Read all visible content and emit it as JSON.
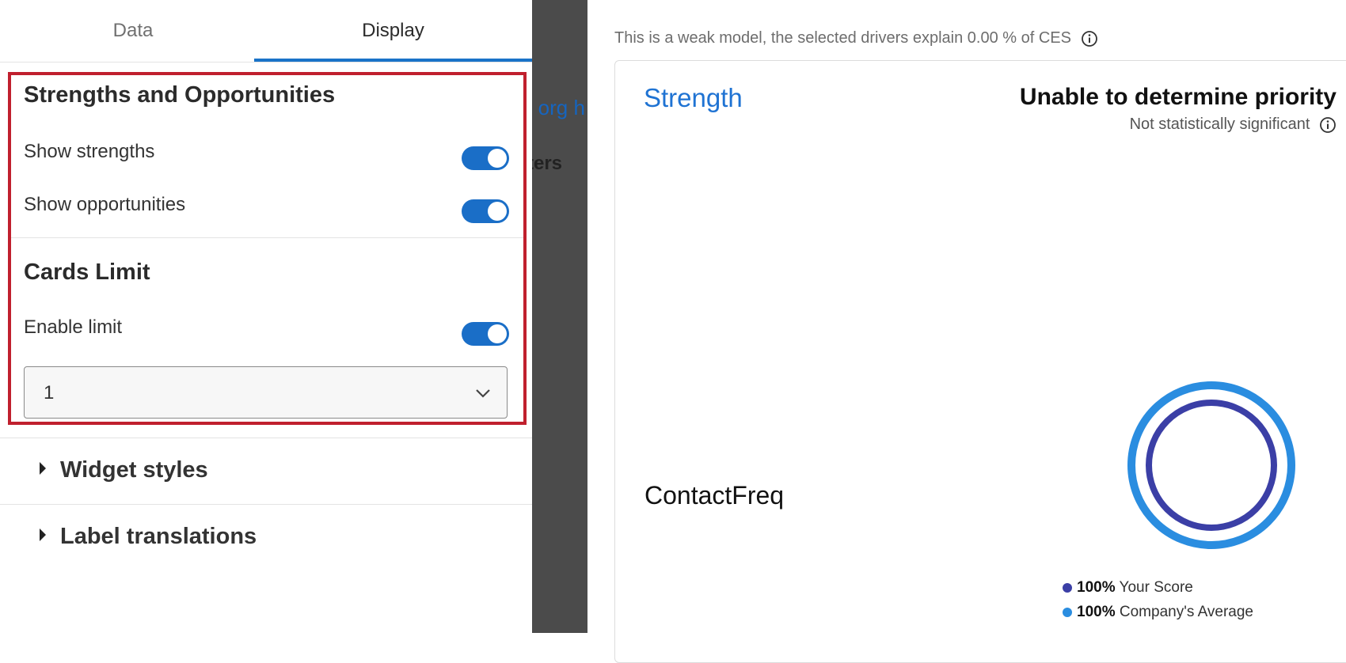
{
  "tabs": {
    "data_label": "Data",
    "display_label": "Display",
    "active": "Display"
  },
  "strengths_section": {
    "title": "Strengths and Opportunities",
    "show_strengths_label": "Show strengths",
    "show_strengths_on": true,
    "show_opportunities_label": "Show opportunities",
    "show_opportunities_on": true
  },
  "cards_limit_section": {
    "title": "Cards Limit",
    "enable_limit_label": "Enable limit",
    "enable_limit_on": true,
    "limit_value": "1"
  },
  "collapsibles": {
    "widget_styles": "Widget styles",
    "label_translations": "Label translations"
  },
  "background_fragments": {
    "link_text": "n org h",
    "bold_text": "ters"
  },
  "widget": {
    "model_note": "This is a weak model, the selected drivers explain 0.00 % of CES",
    "strength_label": "Strength",
    "priority_title": "Unable to determine priority",
    "significance": "Not statistically significant",
    "driver": "ContactFreq",
    "legend": [
      {
        "value": "100%",
        "label": "Your Score",
        "color": "#3b3fa6"
      },
      {
        "value": "100%",
        "label": "Company's Average",
        "color": "#2a8de0"
      }
    ]
  },
  "colors": {
    "accent": "#1a6ec7",
    "highlight_border": "#c0202e",
    "tab_underline": "#1a73c8",
    "strength_text": "#1f73d3"
  }
}
